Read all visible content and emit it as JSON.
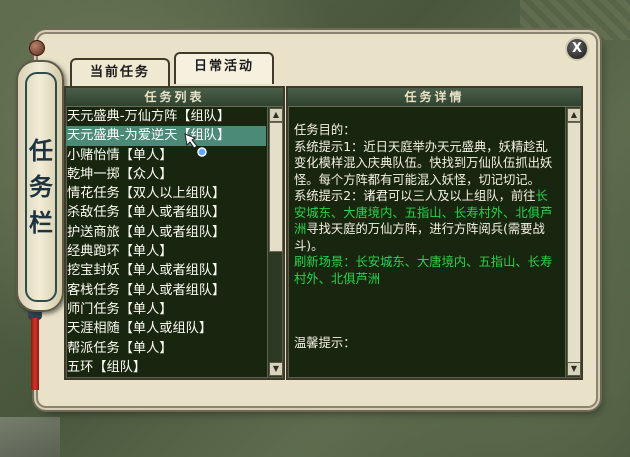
{
  "side_title": [
    "任",
    "务",
    "栏"
  ],
  "tabs": [
    {
      "label": "当前任务",
      "active": false
    },
    {
      "label": "日常活动",
      "active": true
    }
  ],
  "close_label": "X",
  "list_panel": {
    "header": "任务列表",
    "items": [
      "天元盛典-万仙方阵【组队】",
      "天元盛典-为爱逆天【组队】",
      "小赌怡情【单人】",
      "乾坤一掷【众人】",
      "情花任务【双人以上组队】",
      "杀敌任务【单人或者组队】",
      "护送商旅【单人或者组队】",
      "经典跑环【单人】",
      "挖宝封妖【单人或者组队】",
      "客栈任务【单人或者组队】",
      "师门任务【单人】",
      "天涯相随【单人或组队】",
      "帮派任务【单人】",
      "五环【组队】"
    ],
    "selected_index": 1
  },
  "detail_panel": {
    "header": "任务详情",
    "goal_label": "任务目的：",
    "hint1": "系统提示1：近日天庭举办天元盛典，妖精趁乱变化模样混入庆典队伍。快找到万仙队伍抓出妖怪。每个方阵都有可能混入妖怪，切记切记。",
    "hint2_prefix": "系统提示2：诸君可以三人及以上组队，前往",
    "hint2_places": "长安城东、大唐境内、五指山、长寿村外、北俱芦洲",
    "hint2_suffix": "寻找天庭的万仙方阵，进行方阵阅兵(需要战斗)。",
    "refresh_label": "刷新场景：",
    "refresh_places": "长安城东、大唐境内、五指山、长寿村外、北俱芦洲",
    "tips_label": "温馨提示："
  },
  "colors": {
    "panel_bg": "#19260f",
    "selected_row": "#4b8a76",
    "highlight_text": "#27d34a",
    "frame": "#e9e2c9"
  }
}
